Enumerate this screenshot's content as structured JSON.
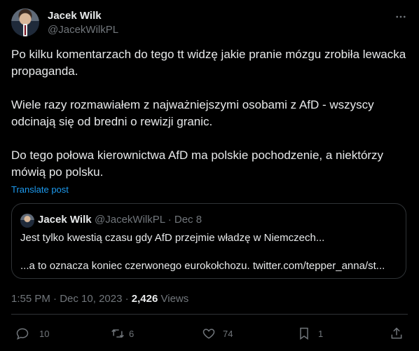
{
  "tweet": {
    "author_name": "Jacek Wilk",
    "author_handle": "@JacekWilkPL",
    "paragraphs": [
      "Po kilku komentarzach do tego tt widzę jakie pranie mózgu zrobiła lewacka propaganda.",
      "Wiele razy rozmawiałem z najważniejszymi osobami z AfD - wszyscy odcinają się od bredni o rewizji granic.",
      "Do tego połowa kierownictwa AfD ma polskie pochodzenie, a niektórzy mówią po polsku."
    ],
    "translate_label": "Translate post",
    "time": "1:55 PM",
    "separator": "·",
    "date": "Dec 10, 2023",
    "views_count": "2,426",
    "views_label": "Views"
  },
  "quote": {
    "author_name": "Jacek Wilk",
    "author_handle": "@JacekWilkPL",
    "separator": "·",
    "date": "Dec 8",
    "line1": "Jest tylko kwestią czasu gdy AfD przejmie władzę w Niemczech...",
    "line2": "...a to oznacza koniec czerwonego eurokołchozu. twitter.com/tepper_anna/st..."
  },
  "actions": {
    "replies": "10",
    "reposts": "6",
    "likes": "74",
    "bookmarks": "1"
  },
  "icons": [
    "more-icon",
    "reply-icon",
    "repost-icon",
    "like-icon",
    "bookmark-icon",
    "share-icon"
  ],
  "colors": {
    "accent": "#1d9bf0",
    "muted": "#71767b",
    "text": "#e7e9ea",
    "border": "#2f3336",
    "background": "#000000"
  }
}
